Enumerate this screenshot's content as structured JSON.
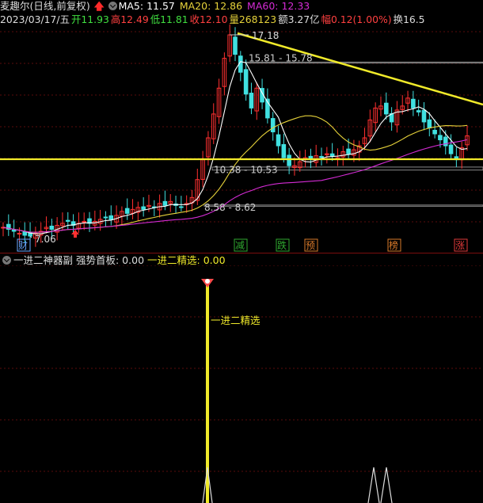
{
  "header": {
    "title": "麦趣尔(日线,前复权)",
    "ma5_label": "MA5: 11.57",
    "ma20_label": "MA20: 12.86",
    "ma60_label": "MA60: 12.33",
    "date": "2023/03/17/五",
    "open": "开11.93",
    "high": "高12.49",
    "low": "低11.81",
    "close": "收12.10",
    "volume": "量268123",
    "amount": "额3.27亿",
    "change": "幅0.12(1.00%)",
    "turnover": "换16.5"
  },
  "colors": {
    "ma5": "#ffffff",
    "ma20": "#e6d23a",
    "ma60": "#d42bd4",
    "up": "#ff3030",
    "down": "#40e0e0",
    "trendline": "#f0ea2a",
    "box": "#8a8a8a"
  },
  "chart_data": {
    "type": "candlestick",
    "annotations": {
      "high_label": "17.18",
      "low_label": "7.06",
      "box1_label": "15.81 - 15.78",
      "box2_label": "10.38 - 10.53",
      "box3_label": "8.58 - 8.62"
    },
    "event_markers": [
      {
        "label": "财",
        "color": "#6aa8ff"
      },
      {
        "label": "减",
        "color": "#2fa82f"
      },
      {
        "label": "跌",
        "color": "#2fa82f"
      },
      {
        "label": "预",
        "color": "#d97a2a"
      },
      {
        "label": "榜",
        "color": "#d97a2a"
      },
      {
        "label": "涨",
        "color": "#e03a3a"
      }
    ],
    "close_approx": [
      7.5,
      7.4,
      7.3,
      7.2,
      7.1,
      7.06,
      7.2,
      7.3,
      7.5,
      7.4,
      7.6,
      7.7,
      7.8,
      7.6,
      7.7,
      7.8,
      7.7,
      7.8,
      7.9,
      8.0,
      7.9,
      8.1,
      8.3,
      8.2,
      8.4,
      8.5,
      8.4,
      8.6,
      8.5,
      8.7,
      8.6,
      8.8,
      8.6,
      8.5,
      8.7,
      9.0,
      9.9,
      10.9,
      12.0,
      13.2,
      14.5,
      16.0,
      17.18,
      16.2,
      15.3,
      14.2,
      13.5,
      14.5,
      13.8,
      13.0,
      12.3,
      11.6,
      11.0,
      10.6,
      10.6,
      10.8,
      11.0,
      10.9,
      11.1,
      11.0,
      11.2,
      11.1,
      11.0,
      11.3,
      11.2,
      11.4,
      11.6,
      12.0,
      12.9,
      13.5,
      13.6,
      13.2,
      12.8,
      13.4,
      13.6,
      14.0,
      13.5,
      13.3,
      12.8,
      12.5,
      12.2,
      11.9,
      11.6,
      11.2,
      10.9,
      11.5,
      12.1
    ]
  },
  "indicator": {
    "title": "一进二神器副",
    "strong_label": "强势首板: 0.00",
    "pick_label": "一进二精选: 0.00",
    "pick_annotation": "一进二精选"
  }
}
